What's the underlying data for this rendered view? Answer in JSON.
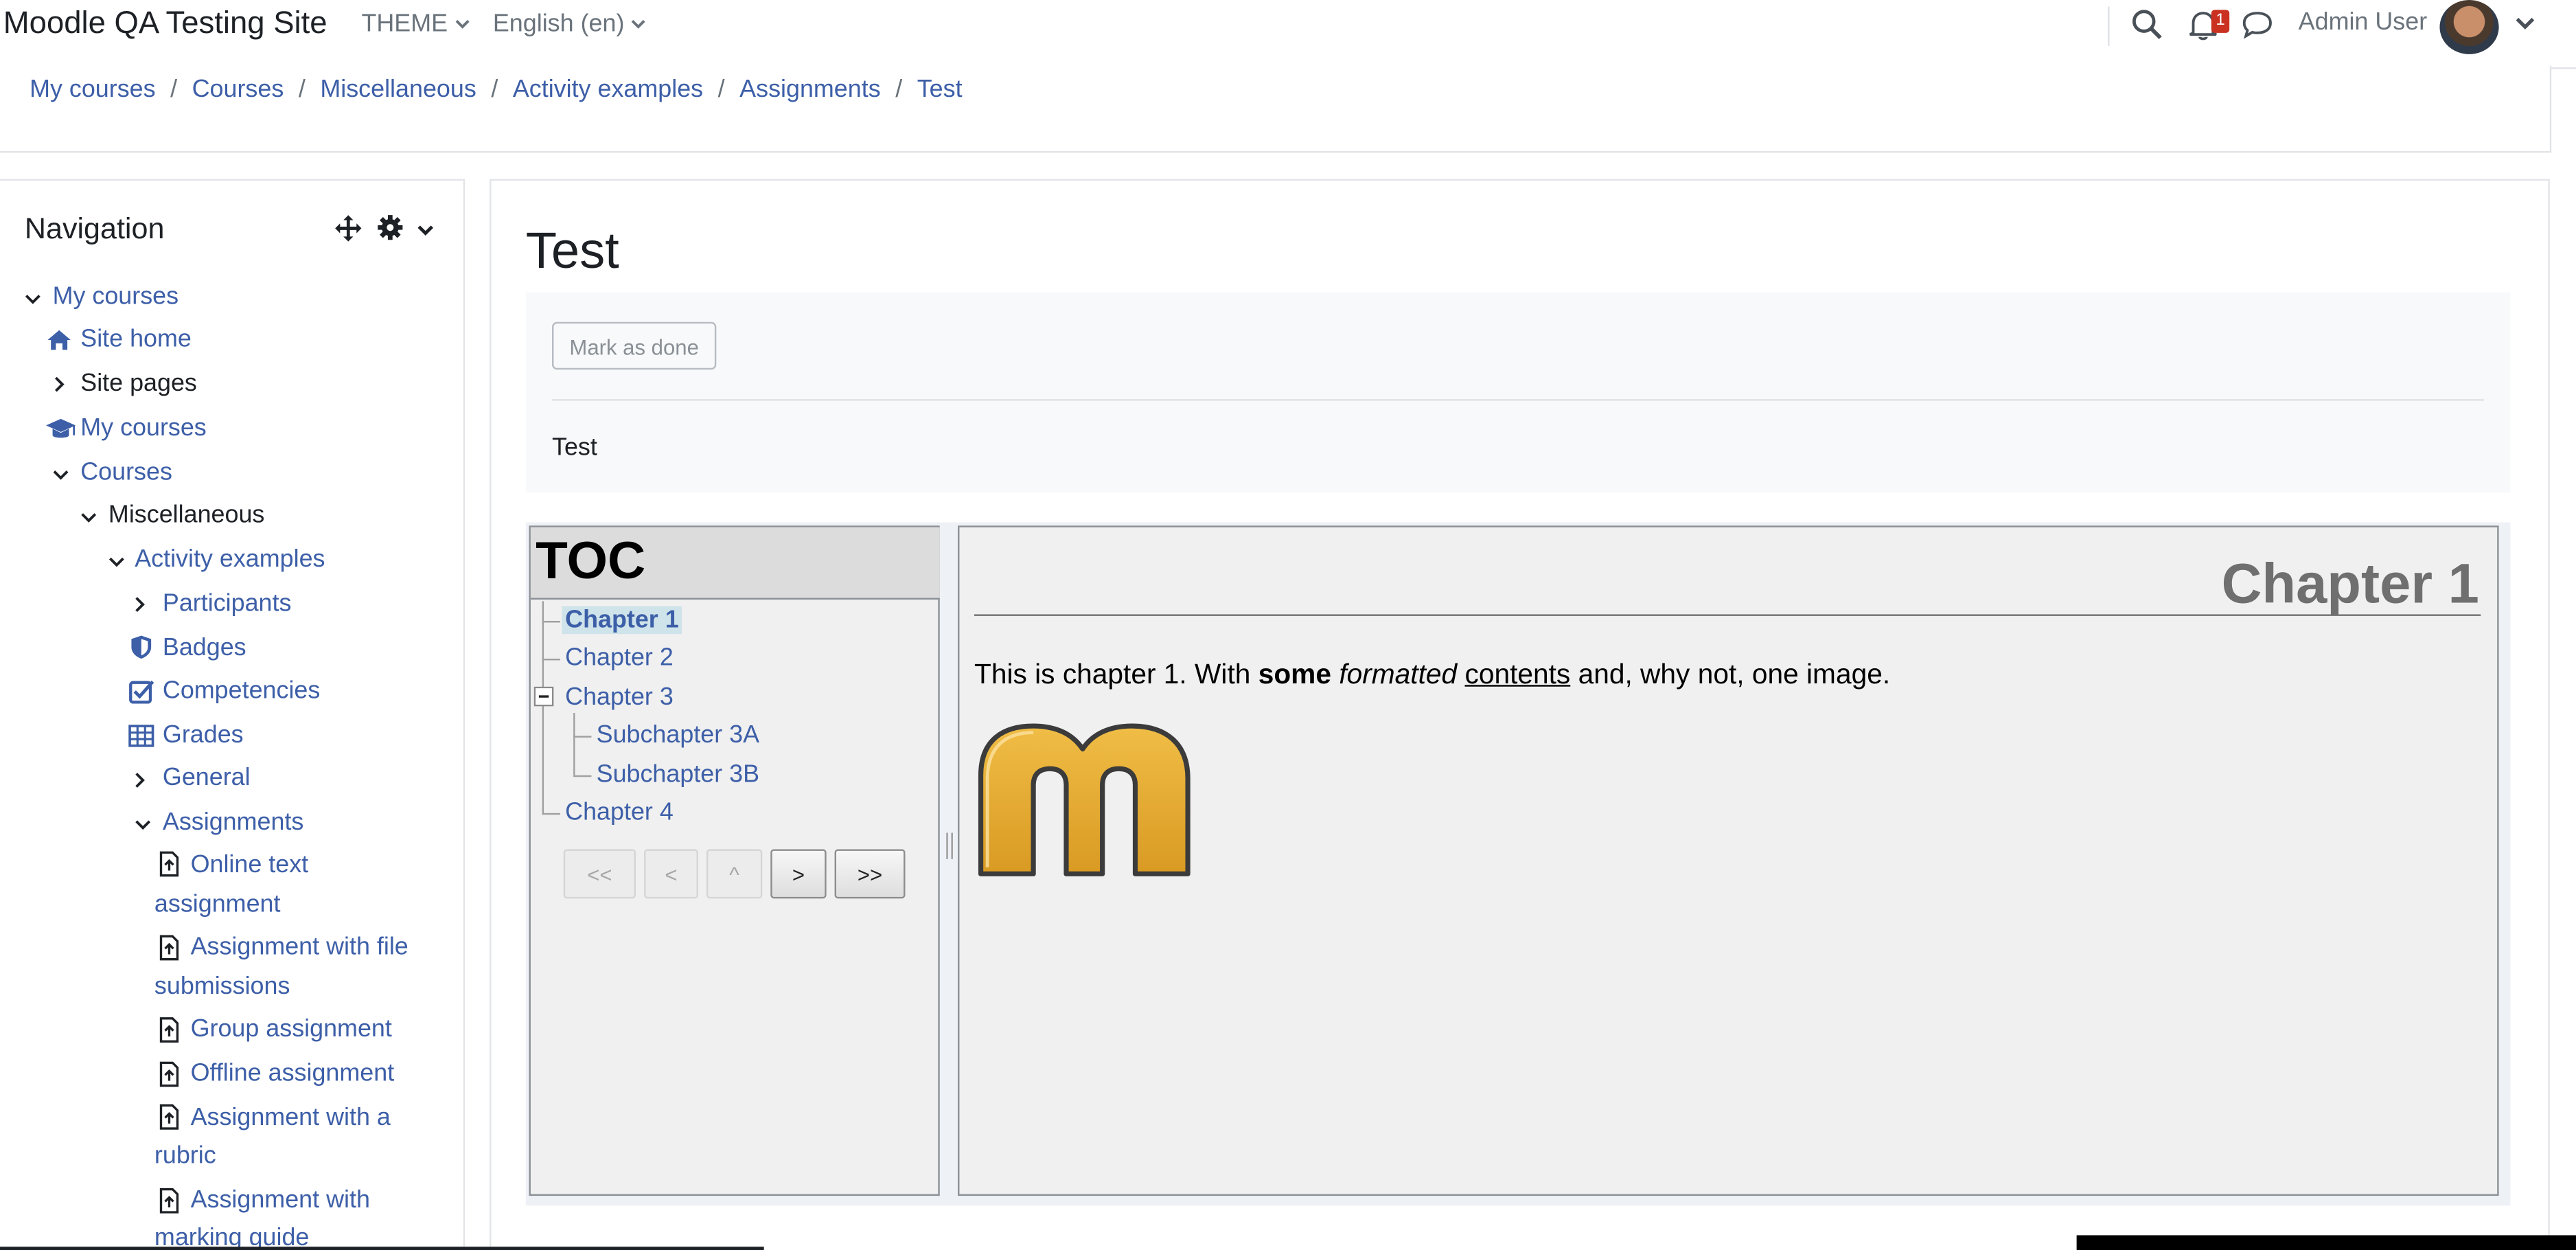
{
  "header": {
    "site_name": "Moodle QA Testing Site",
    "theme_menu": "THEME",
    "language_menu": "English (en)",
    "notification_count": "1",
    "user_name": "Admin User"
  },
  "breadcrumb": [
    "My courses",
    "Courses",
    "Miscellaneous",
    "Activity examples",
    "Assignments",
    "Test"
  ],
  "navigation": {
    "title": "Navigation",
    "items": [
      {
        "label": "My courses"
      },
      {
        "label": "Site home"
      },
      {
        "label": "Site pages"
      },
      {
        "label": "My courses"
      },
      {
        "label": "Courses"
      },
      {
        "label": "Miscellaneous"
      },
      {
        "label": "Activity examples"
      },
      {
        "label": "Participants"
      },
      {
        "label": "Badges"
      },
      {
        "label": "Competencies"
      },
      {
        "label": "Grades"
      },
      {
        "label": "General"
      },
      {
        "label": "Assignments"
      },
      {
        "label_line1": "Online text",
        "label_line2": "assignment"
      },
      {
        "label_line1": "Assignment with file",
        "label_line2": "submissions"
      },
      {
        "label": "Group assignment"
      },
      {
        "label": "Offline assignment"
      },
      {
        "label_line1": "Assignment with a",
        "label_line2": "rubric"
      },
      {
        "label_line1": "Assignment with",
        "label_line2": "marking guide"
      }
    ]
  },
  "main": {
    "title": "Test",
    "mark_done_label": "Mark as done",
    "intro": "Test"
  },
  "book": {
    "toc_title": "TOC",
    "chapters": [
      {
        "label": "Chapter 1",
        "current": true
      },
      {
        "label": "Chapter 2"
      },
      {
        "label": "Chapter 3"
      },
      {
        "label": "Subchapter 3A"
      },
      {
        "label": "Subchapter 3B"
      },
      {
        "label": "Chapter 4"
      }
    ],
    "nav_buttons": {
      "first": "<<",
      "prev": "<",
      "up": "^",
      "next": ">",
      "last": ">>"
    },
    "chapter_heading": "Chapter 1",
    "chapter_text": {
      "part1": "This is chapter 1. With ",
      "bold": "some",
      "italic": "formatted",
      "underline": "contents",
      "part2": " and, why not, one image."
    },
    "image_letter": "m"
  },
  "colors": {
    "link": "#3d5fa8",
    "badge": "#ca3120",
    "moodle_orange": "#e8ab32"
  }
}
